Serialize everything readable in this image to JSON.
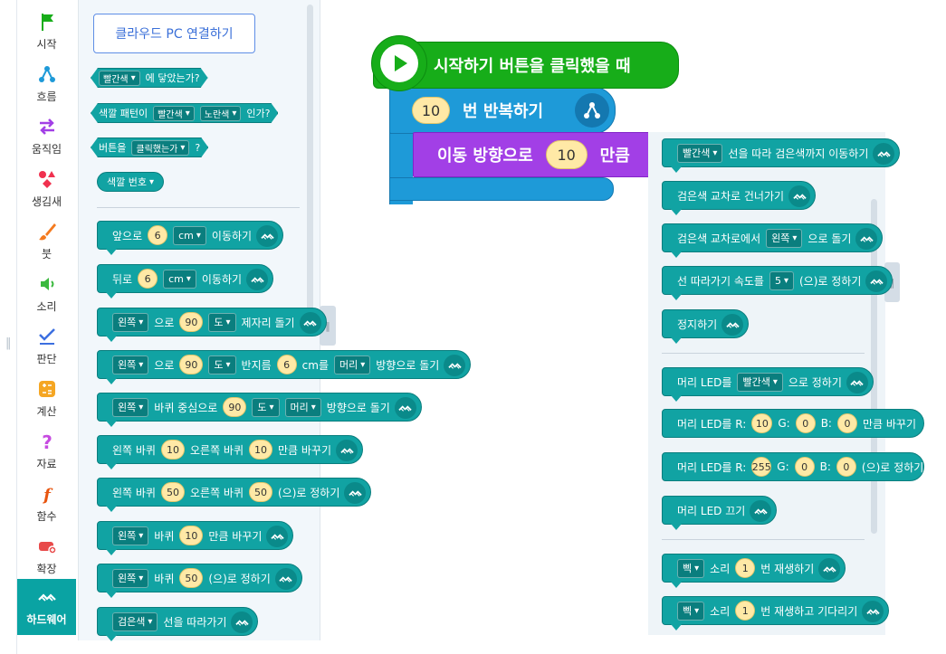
{
  "categories": [
    {
      "label": "시작",
      "icon": "flag-icon"
    },
    {
      "label": "흐름",
      "icon": "flow-icon"
    },
    {
      "label": "움직임",
      "icon": "arrows-icon"
    },
    {
      "label": "생김새",
      "icon": "shapes-icon"
    },
    {
      "label": "붓",
      "icon": "brush-icon"
    },
    {
      "label": "소리",
      "icon": "speaker-icon"
    },
    {
      "label": "판단",
      "icon": "check-icon"
    },
    {
      "label": "계산",
      "icon": "calculator-icon"
    },
    {
      "label": "자료",
      "icon": "question-icon"
    },
    {
      "label": "함수",
      "icon": "function-icon"
    },
    {
      "label": "확장",
      "icon": "extension-icon"
    },
    {
      "label": "하드웨어",
      "icon": "hardware-icon"
    }
  ],
  "palette": {
    "connect_button": "클라우드 PC 연결하기",
    "sensor_blocks": {
      "color_touch": {
        "color": "빨간색",
        "suffix": "에 닿았는가?"
      },
      "color_pattern": {
        "prefix": "색깔 패턴이",
        "color1": "빨간색",
        "color2": "노란색",
        "suffix": "인가?"
      },
      "button_clicked": {
        "prefix": "버튼을",
        "state": "클릭했는가",
        "suffix": "?"
      },
      "color_number": {
        "label": "색깔 번호"
      }
    },
    "blocks": [
      {
        "parts": [
          {
            "t": "txt",
            "v": "앞으로"
          },
          {
            "t": "num",
            "v": "6"
          },
          {
            "t": "dd",
            "v": "cm"
          },
          {
            "t": "txt",
            "v": "이동하기"
          }
        ]
      },
      {
        "parts": [
          {
            "t": "txt",
            "v": "뒤로"
          },
          {
            "t": "num",
            "v": "6"
          },
          {
            "t": "dd",
            "v": "cm"
          },
          {
            "t": "txt",
            "v": "이동하기"
          }
        ]
      },
      {
        "parts": [
          {
            "t": "dd",
            "v": "왼쪽"
          },
          {
            "t": "txt",
            "v": "으로"
          },
          {
            "t": "num",
            "v": "90"
          },
          {
            "t": "dd",
            "v": "도"
          },
          {
            "t": "txt",
            "v": "제자리 돌기"
          }
        ]
      },
      {
        "parts": [
          {
            "t": "dd",
            "v": "왼쪽"
          },
          {
            "t": "txt",
            "v": "으로"
          },
          {
            "t": "num",
            "v": "90"
          },
          {
            "t": "dd",
            "v": "도"
          },
          {
            "t": "txt",
            "v": "반지름"
          },
          {
            "t": "num",
            "v": "6"
          },
          {
            "t": "txt",
            "v": "cm를"
          },
          {
            "t": "dd",
            "v": "머리"
          },
          {
            "t": "txt",
            "v": "방향으로 돌기"
          }
        ]
      },
      {
        "parts": [
          {
            "t": "dd",
            "v": "왼쪽"
          },
          {
            "t": "txt",
            "v": "바퀴 중심으로"
          },
          {
            "t": "num",
            "v": "90"
          },
          {
            "t": "dd",
            "v": "도"
          },
          {
            "t": "dd",
            "v": "머리"
          },
          {
            "t": "txt",
            "v": "방향으로 돌기"
          }
        ]
      },
      {
        "parts": [
          {
            "t": "txt",
            "v": "왼쪽 바퀴"
          },
          {
            "t": "num",
            "v": "10"
          },
          {
            "t": "txt",
            "v": "오른쪽 바퀴"
          },
          {
            "t": "num",
            "v": "10"
          },
          {
            "t": "txt",
            "v": "만큼 바꾸기"
          }
        ]
      },
      {
        "parts": [
          {
            "t": "txt",
            "v": "왼쪽 바퀴"
          },
          {
            "t": "num",
            "v": "50"
          },
          {
            "t": "txt",
            "v": "오른쪽 바퀴"
          },
          {
            "t": "num",
            "v": "50"
          },
          {
            "t": "txt",
            "v": "(으)로 정하기"
          }
        ]
      },
      {
        "parts": [
          {
            "t": "dd",
            "v": "왼쪽"
          },
          {
            "t": "txt",
            "v": "바퀴"
          },
          {
            "t": "num",
            "v": "10"
          },
          {
            "t": "txt",
            "v": "만큼 바꾸기"
          }
        ]
      },
      {
        "parts": [
          {
            "t": "dd",
            "v": "왼쪽"
          },
          {
            "t": "txt",
            "v": "바퀴"
          },
          {
            "t": "num",
            "v": "50"
          },
          {
            "t": "txt",
            "v": "(으)로 정하기"
          }
        ]
      },
      {
        "parts": [
          {
            "t": "dd",
            "v": "검은색"
          },
          {
            "t": "txt",
            "v": "선을 따라가기"
          }
        ]
      }
    ]
  },
  "flyout": {
    "blocks": [
      {
        "parts": [
          {
            "t": "dd",
            "v": "빨간색"
          },
          {
            "t": "txt",
            "v": "선을 따라 검은색까지 이동하기"
          }
        ]
      },
      {
        "parts": [
          {
            "t": "txt",
            "v": "검은색 교차로 건너가기"
          }
        ]
      },
      {
        "parts": [
          {
            "t": "txt",
            "v": "검은색 교차로에서"
          },
          {
            "t": "dd",
            "v": "왼쪽"
          },
          {
            "t": "txt",
            "v": "으로 돌기"
          }
        ]
      },
      {
        "parts": [
          {
            "t": "txt",
            "v": "선 따라가기 속도를"
          },
          {
            "t": "dd",
            "v": "5"
          },
          {
            "t": "txt",
            "v": "(으)로 정하기"
          }
        ]
      },
      {
        "parts": [
          {
            "t": "txt",
            "v": "정지하기"
          }
        ]
      },
      {
        "parts": [
          {
            "t": "txt",
            "v": "머리 LED를"
          },
          {
            "t": "dd",
            "v": "빨간색"
          },
          {
            "t": "txt",
            "v": "으로 정하기"
          }
        ]
      },
      {
        "parts": [
          {
            "t": "txt",
            "v": "머리 LED를 R:"
          },
          {
            "t": "num",
            "v": "10"
          },
          {
            "t": "txt",
            "v": "G:"
          },
          {
            "t": "num",
            "v": "0"
          },
          {
            "t": "txt",
            "v": "B:"
          },
          {
            "t": "num",
            "v": "0"
          },
          {
            "t": "txt",
            "v": "만큼 바꾸기"
          }
        ]
      },
      {
        "parts": [
          {
            "t": "txt",
            "v": "머리 LED를 R:"
          },
          {
            "t": "num",
            "v": "255"
          },
          {
            "t": "txt",
            "v": "G:"
          },
          {
            "t": "num",
            "v": "0"
          },
          {
            "t": "txt",
            "v": "B:"
          },
          {
            "t": "num",
            "v": "0"
          },
          {
            "t": "txt",
            "v": "(으)로 정하기"
          }
        ]
      },
      {
        "parts": [
          {
            "t": "txt",
            "v": "머리 LED 끄기"
          }
        ]
      },
      {
        "parts": [
          {
            "t": "dd",
            "v": "삑"
          },
          {
            "t": "txt",
            "v": "소리"
          },
          {
            "t": "num",
            "v": "1"
          },
          {
            "t": "txt",
            "v": "번 재생하기"
          }
        ]
      },
      {
        "parts": [
          {
            "t": "dd",
            "v": "삑"
          },
          {
            "t": "txt",
            "v": "소리"
          },
          {
            "t": "num",
            "v": "1"
          },
          {
            "t": "txt",
            "v": "번 재생하고 기다리기"
          }
        ]
      }
    ]
  },
  "script": {
    "hat_label": "시작하기 버튼을 클릭했을 때",
    "repeat_count": "10",
    "repeat_label": "번 반복하기",
    "move_prefix": "이동 방향으로",
    "move_value": "10",
    "move_suffix": "만큼"
  },
  "colors": {
    "hardware": "#11a3a3",
    "start": "#17ad19",
    "flow": "#1e9ad8",
    "motion": "#a23fe6"
  }
}
